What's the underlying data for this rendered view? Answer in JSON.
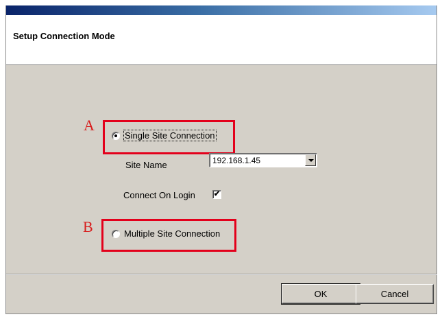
{
  "dialog": {
    "title": "Setup Connection Mode"
  },
  "annotations": {
    "a": "A",
    "b": "B"
  },
  "options": {
    "single_site": {
      "label": "Single Site Connection",
      "selected": true
    },
    "multiple_site": {
      "label": "Multiple Site Connection",
      "selected": false
    }
  },
  "site_name": {
    "label": "Site Name",
    "value": "192.168.1.45"
  },
  "connect_on_login": {
    "label": "Connect On Login",
    "checked": true,
    "mark": "✔"
  },
  "buttons": {
    "ok": "OK",
    "cancel": "Cancel"
  },
  "colors": {
    "annotation_red": "#e3001b",
    "dialog_bg": "#d4d0c8"
  }
}
